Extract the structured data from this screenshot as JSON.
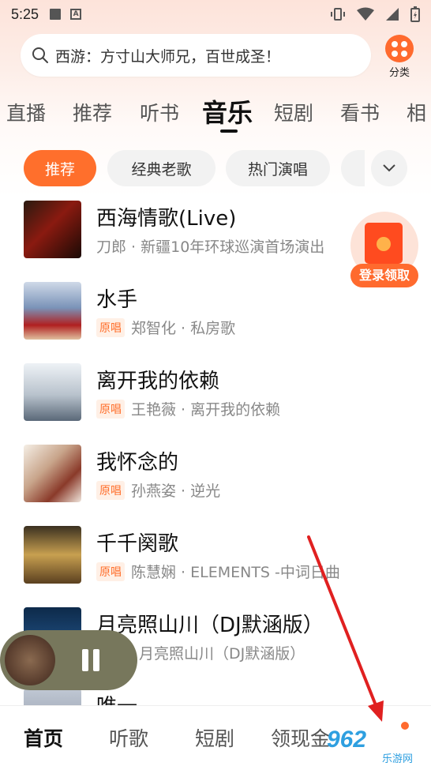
{
  "status_bar": {
    "time": "5:25"
  },
  "search": {
    "placeholder": "西游：方寸山大师兄，百世成圣！"
  },
  "category": {
    "label": "分类"
  },
  "tabs": [
    {
      "label": "直播"
    },
    {
      "label": "推荐"
    },
    {
      "label": "听书"
    },
    {
      "label": "音乐",
      "active": true
    },
    {
      "label": "短剧"
    },
    {
      "label": "看书"
    },
    {
      "label": "相"
    }
  ],
  "chips": [
    {
      "label": "推荐",
      "active": true
    },
    {
      "label": "经典老歌"
    },
    {
      "label": "热门演唱"
    }
  ],
  "songs": [
    {
      "title": "西海情歌(Live)",
      "badge": "",
      "sub": "刀郎 · 新疆10年环球巡演首场演出"
    },
    {
      "title": "水手",
      "badge": "原唱",
      "sub": "郑智化 · 私房歌"
    },
    {
      "title": "离开我的依赖",
      "badge": "原唱",
      "sub": "王艳薇 · 离开我的依赖"
    },
    {
      "title": "我怀念的",
      "badge": "原唱",
      "sub": "孙燕姿 · 逆光"
    },
    {
      "title": "千千阕歌",
      "badge": "原唱",
      "sub": "陈慧娴 · ELEMENTS -中词日曲"
    },
    {
      "title": "月亮照山川（DJ默涵版）",
      "badge": "",
      "sub": "月亮照山川（DJ默涵版）"
    },
    {
      "title": "唯一",
      "badge": "",
      "sub": ""
    }
  ],
  "reward": {
    "label": "登录领取"
  },
  "bottom_nav": [
    {
      "label": "首页",
      "active": true
    },
    {
      "label": "听歌"
    },
    {
      "label": "短剧"
    },
    {
      "label": "领现金"
    }
  ],
  "watermark": {
    "main": "962",
    "sub": "乐游网"
  },
  "colors": {
    "accent": "#ff6f2c",
    "annotation_arrow": "#e02020"
  }
}
